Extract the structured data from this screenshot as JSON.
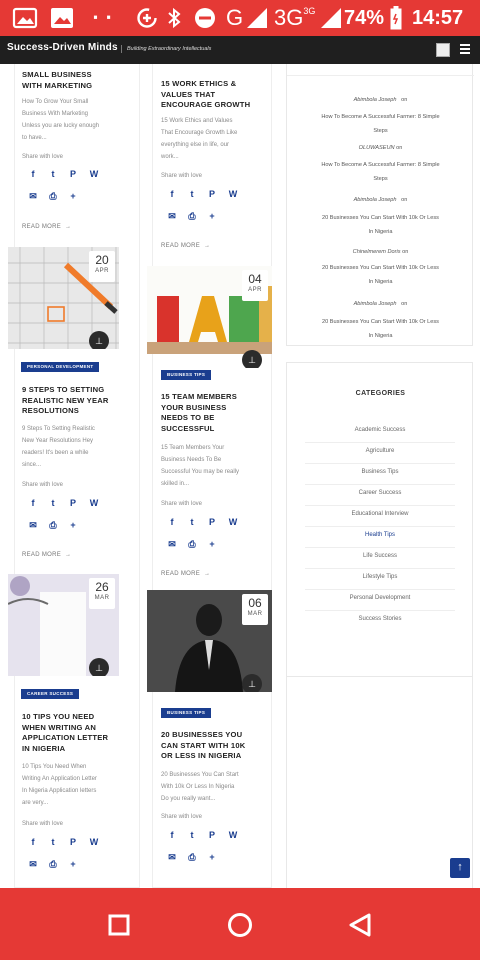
{
  "status_bar": {
    "battery": "74%",
    "time": "14:57",
    "network": "3G",
    "network_sup": "3G",
    "icons": [
      "gallery-icon",
      "image-icon",
      "dots-icon",
      "data-saver-icon",
      "bluetooth-icon",
      "do-not-disturb-icon",
      "signal-icon",
      "signal-3g-icon",
      "battery-icon"
    ]
  },
  "header": {
    "title": "Success-Driven Minds",
    "tagline": "Building Extraordinary Intellectuals",
    "icons": [
      "image-icon",
      "menu-icon"
    ]
  },
  "colors": {
    "status_bar": "#e53935",
    "header": "#1f1f1f",
    "category_badge": "#1a3d8f",
    "social_icons": "#1a3d8f"
  },
  "share_text": "Share with love",
  "read_more": "READ MORE",
  "share_buttons": [
    "Facebook",
    "Twitter",
    "Pinterest",
    "WhatsApp",
    "Email",
    "Print",
    "Share"
  ],
  "posts_col1": [
    {
      "title_lines": [
        "SMALL BUSINESS",
        "WITH MARKETING"
      ],
      "excerpt_lines": [
        "How To Grow Your Small",
        "Business With Marketing",
        "Unless you are lucky enough",
        "to have..."
      ]
    },
    {
      "day": "20",
      "month": "APR",
      "category": "PERSONAL DEVELOPMENT",
      "title_lines": [
        "9 STEPS TO SETTING",
        "REALISTIC NEW YEAR",
        "RESOLUTIONS"
      ],
      "excerpt_lines": [
        "9 Steps To Setting Realistic",
        "New Year Resolutions Hey",
        "readers! It's been a while",
        "since..."
      ]
    },
    {
      "day": "26",
      "month": "MAR",
      "category": "CAREER SUCCESS",
      "title_lines": [
        "10 TIPS YOU NEED",
        "WHEN WRITING AN",
        "APPLICATION LETTER",
        "IN NIGERIA"
      ],
      "excerpt_lines": [
        "10 Tips You Need When",
        "Writing An Application Letter",
        "In Nigeria Application letters",
        "are very..."
      ]
    }
  ],
  "posts_col2": [
    {
      "title_lines": [
        "15 WORK ETHICS &",
        "VALUES THAT",
        "ENCOURAGE GROWTH"
      ],
      "excerpt_lines": [
        "15 Work Ethics and Values",
        "That Encourage Growth Like",
        "everything else in life, our",
        "work..."
      ]
    },
    {
      "day": "04",
      "month": "APR",
      "category": "BUSINESS TIPS",
      "title_lines": [
        "15 TEAM MEMBERS",
        "YOUR BUSINESS",
        "NEEDS TO BE",
        "SUCCESSFUL"
      ],
      "excerpt_lines": [
        "15 Team Members Your",
        "Business Needs To Be",
        "Successful You may be really",
        "skilled in..."
      ]
    },
    {
      "day": "06",
      "month": "MAR",
      "category": "BUSINESS TIPS",
      "title_lines": [
        "20 BUSINESSES YOU",
        "CAN START WITH 10K",
        "OR LESS IN NIGERIA"
      ],
      "excerpt_lines": [
        "20 Businesses You Can Start",
        "With 10k Or Less In Nigeria",
        "Do you really want..."
      ]
    }
  ],
  "comments": [
    {
      "author": "Abimbola Joseph",
      "on": "on",
      "post_lines": [
        "How To Become A Successful Farmer: 8 Simple",
        "Steps"
      ]
    },
    {
      "author": "OLUWASEUN",
      "on": "on",
      "post_lines": [
        "How To Become A Successful Farmer: 8 Simple",
        "Steps"
      ]
    },
    {
      "author": "Abimbola Joseph",
      "on": "on",
      "post_lines": [
        "20 Businesses You Can Start With 10k Or Less",
        "In Nigeria"
      ]
    },
    {
      "author": "Chinelmerem Doris",
      "on": "on",
      "post_lines": [
        "20 Businesses You Can Start With 10k Or Less",
        "In Nigeria"
      ]
    },
    {
      "author": "Abimbola Joseph",
      "on": "on",
      "post_lines": [
        "20 Businesses You Can Start With 10k Or Less",
        "In Nigeria"
      ]
    }
  ],
  "categories": {
    "title": "CATEGORIES",
    "items": [
      "Academic Success",
      "Agriculture",
      "Business Tips",
      "Career Success",
      "Educational Interview",
      "Health Tips",
      "Life Success",
      "Lifestyle Tips",
      "Personal Development",
      "Success Stories"
    ],
    "active": "Health Tips"
  },
  "nav_bar": {
    "icons": [
      "recents-square-icon",
      "home-circle-icon",
      "back-triangle-icon"
    ]
  }
}
